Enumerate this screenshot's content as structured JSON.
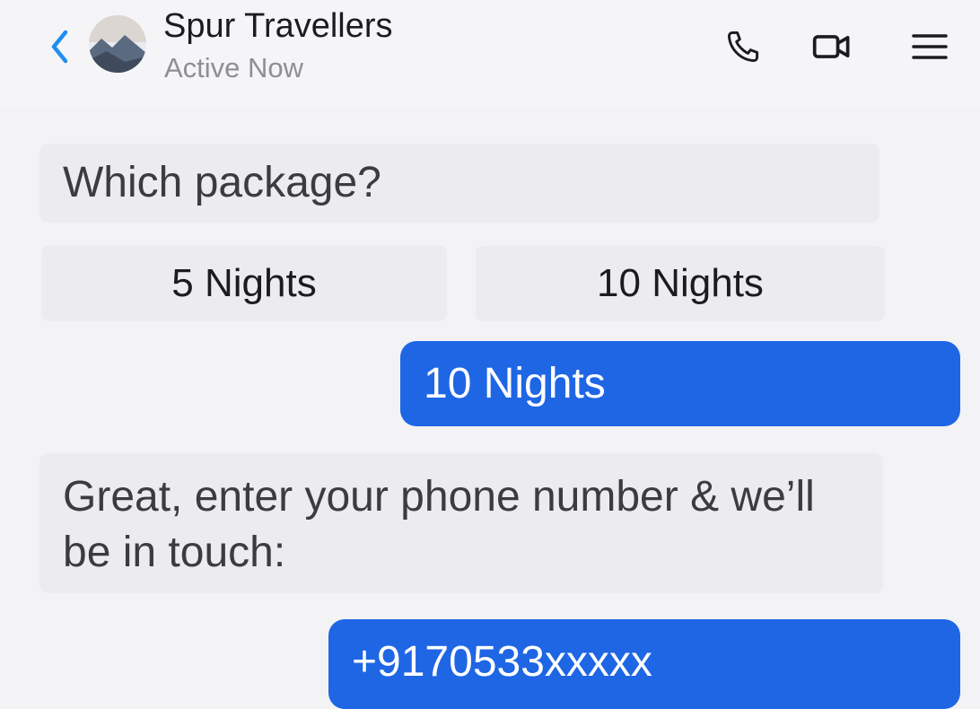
{
  "header": {
    "back_icon": "chevron-left-icon",
    "title": "Spur Travellers",
    "status": "Active Now",
    "icons": [
      "phone-icon",
      "video-icon",
      "menu-icon"
    ],
    "accent_color": "#1f8ef1"
  },
  "messages": {
    "question_1": "Which package?",
    "options": [
      "5 Nights",
      "10 Nights"
    ],
    "reply_1": "10 Nights",
    "question_2": "Great, enter your phone number & we’ll be in touch:",
    "reply_2": "+9170533xxxxx"
  },
  "colors": {
    "outgoing_bubble": "#1f66e5",
    "incoming_bubble": "#ececee"
  }
}
